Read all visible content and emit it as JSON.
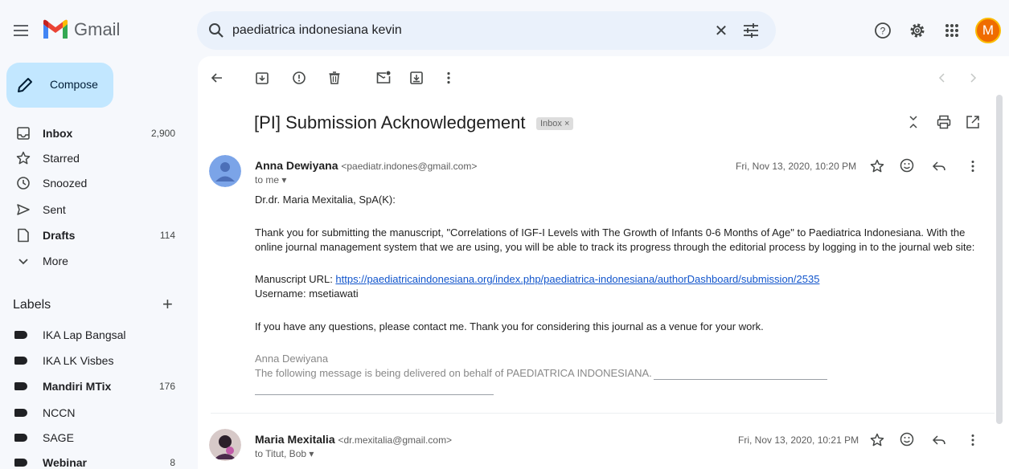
{
  "header": {
    "app_name": "Gmail",
    "search_query": "paediatrica indonesiana kevin",
    "avatar_initial": "M"
  },
  "sidebar": {
    "compose_label": "Compose",
    "items": [
      {
        "label": "Inbox",
        "count": "2,900",
        "bold": true,
        "icon": "inbox-icon"
      },
      {
        "label": "Starred",
        "count": "",
        "bold": false,
        "icon": "star-icon"
      },
      {
        "label": "Snoozed",
        "count": "",
        "bold": false,
        "icon": "clock-icon"
      },
      {
        "label": "Sent",
        "count": "",
        "bold": false,
        "icon": "send-icon"
      },
      {
        "label": "Drafts",
        "count": "114",
        "bold": true,
        "icon": "draft-icon"
      },
      {
        "label": "More",
        "count": "",
        "bold": false,
        "icon": "chevron-down-icon"
      }
    ],
    "labels_title": "Labels",
    "labels": [
      {
        "label": "IKA Lap Bangsal",
        "count": "",
        "bold": false
      },
      {
        "label": "IKA LK Visbes",
        "count": "",
        "bold": false
      },
      {
        "label": "Mandiri MTix",
        "count": "176",
        "bold": true
      },
      {
        "label": "NCCN",
        "count": "",
        "bold": false
      },
      {
        "label": "SAGE",
        "count": "",
        "bold": false
      },
      {
        "label": "Webinar",
        "count": "8",
        "bold": true
      }
    ]
  },
  "thread": {
    "subject": "[PI] Submission Acknowledgement",
    "inbox_chip": "Inbox ×",
    "messages": [
      {
        "sender_name": "Anna Dewiyana",
        "sender_email": "<paediatr.indones@gmail.com>",
        "to": "to me ▾",
        "date": "Fri, Nov 13, 2020, 10:20 PM",
        "body": {
          "greeting": "Dr.dr. Maria Mexitalia, SpA(K):",
          "paragraph1_line1": "Thank you for submitting the manuscript, \"Correlations of IGF-I Levels with The Growth of Infants 0-6 Months of Age\" to Paediatrica Indonesiana. With the",
          "paragraph1_line2": "online journal management system that we are using, you will be able to track its progress through the editorial process by logging in to the journal web site:",
          "url_label": "Manuscript URL: ",
          "url": "https://paediatricaindonesiana.org/index.php/paediatrica-indonesiana/authorDashboard/submission/2535",
          "username": "Username: msetiawati",
          "closing": "If you have any questions, please contact me. Thank you for considering this journal as a venue for your work.",
          "sig_name": "Anna Dewiyana",
          "sig_note": "The following message is being delivered on behalf of PAEDIATRICA INDONESIANA."
        }
      },
      {
        "sender_name": "Maria Mexitalia",
        "sender_email": "<dr.mexitalia@gmail.com>",
        "to": "to Titut, Bob ▾",
        "date": "Fri, Nov 13, 2020, 10:21 PM"
      }
    ]
  },
  "colors": {
    "background": "#f6f8fc",
    "compose_bg": "#c2e7ff",
    "search_bg": "#eaf1fb",
    "link": "#1155cc",
    "avatar_top": "#ef6c00"
  }
}
